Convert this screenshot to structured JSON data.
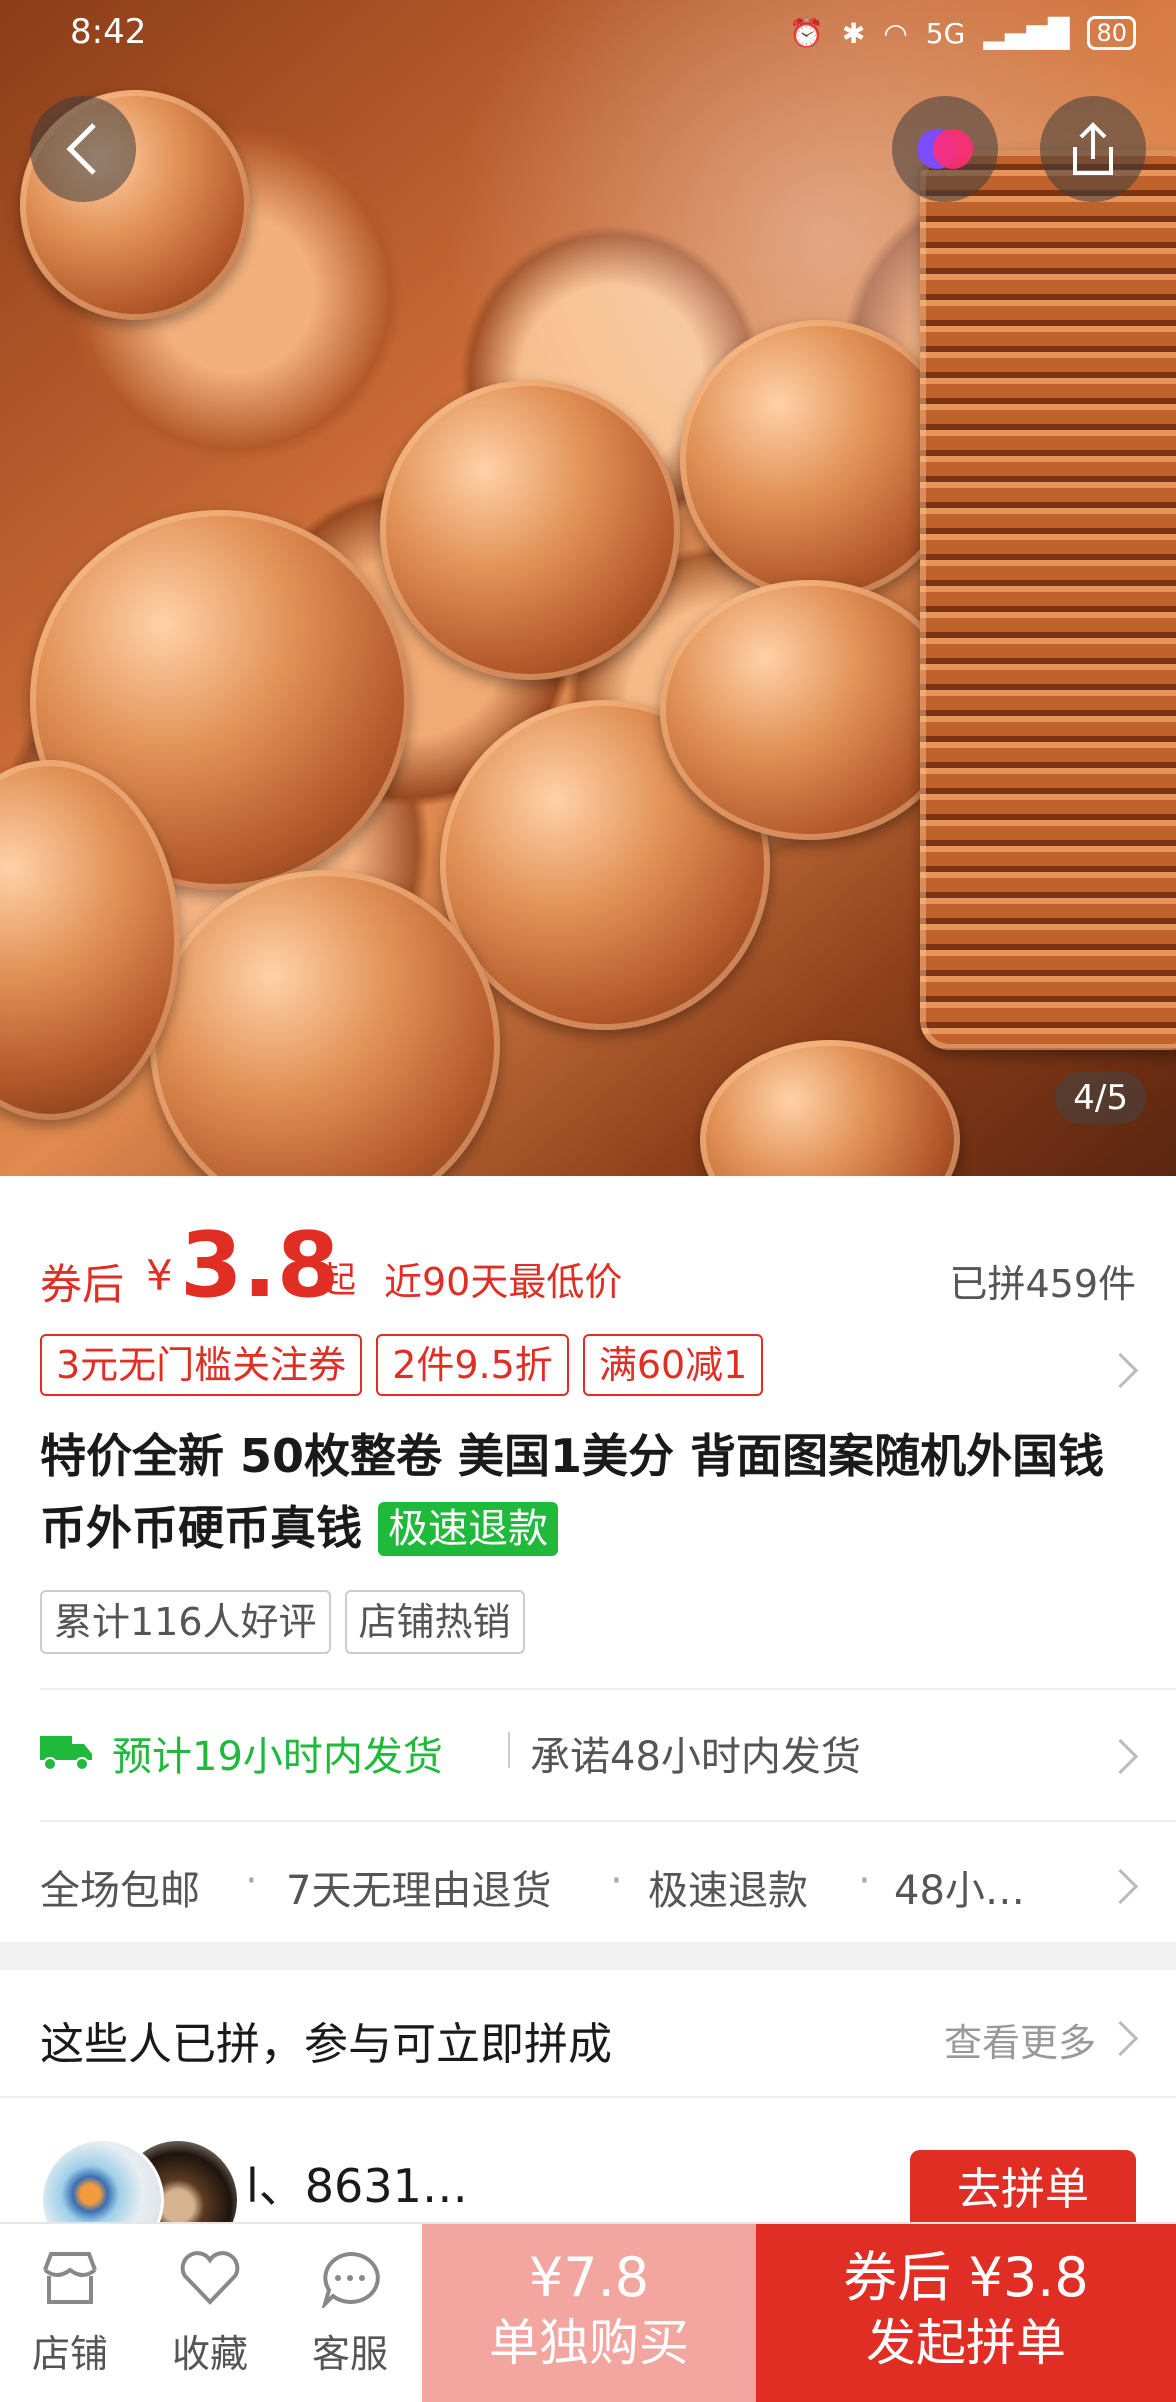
{
  "status_bar": {
    "time": "8:42",
    "icons_left": "支 N",
    "battery": "80",
    "network": "5G"
  },
  "hero": {
    "page_indicator": "4/5"
  },
  "price": {
    "prefix": "券后",
    "currency": "¥",
    "amount": "3.8",
    "suffix": "起",
    "tag": "近90天最低价",
    "sold": "已拼459件"
  },
  "coupons": [
    "3元无门槛关注券",
    "2件9.5折",
    "满60减1"
  ],
  "title": {
    "text": "特价全新 50枚整卷 美国1美分 背面图案随机外国钱币外币硬币真钱",
    "badge": "极速退款"
  },
  "tags": [
    "累计116人好评",
    "店铺热销"
  ],
  "shipping": {
    "estimate": "预计19小时内发货",
    "promise": "承诺48小时内发货"
  },
  "services": [
    "全场包邮",
    "7天无理由退货",
    "极速退款",
    "48小…"
  ],
  "group": {
    "title": "这些人已拼，参与可立即拼成",
    "more": "查看更多",
    "member_name": "l、8631…",
    "join_label": "去拼单"
  },
  "bottom_nav": {
    "store": "店铺",
    "favorite": "收藏",
    "service": "客服",
    "solo_price": "¥7.8",
    "solo_label": "单独购买",
    "group_price": "券后 ¥3.8",
    "group_label": "发起拼单"
  },
  "colors": {
    "accent": "#e02e24",
    "green": "#1fb93c",
    "solo_btn": "#f3a5a0"
  }
}
